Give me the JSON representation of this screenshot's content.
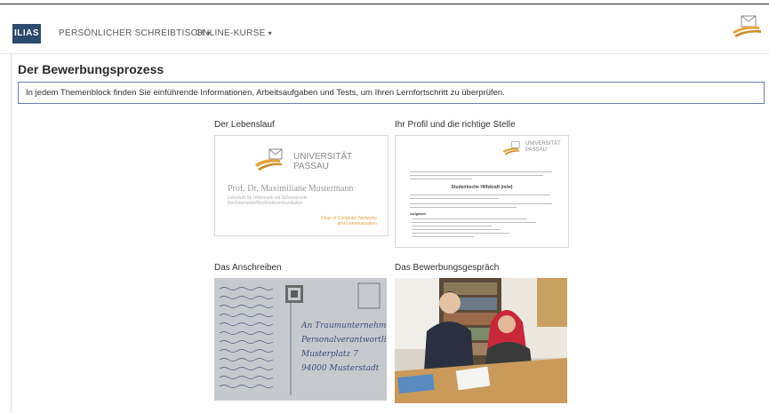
{
  "header": {
    "logo_text": "ILIAS",
    "nav": [
      {
        "label": "PERSÖNLICHER SCHREIBTISCH"
      },
      {
        "label": "ONLINE-KURSE"
      }
    ]
  },
  "page": {
    "title": "Der Bewerbungsprozess",
    "info": "In jedem Themenblock finden Sie einführende Informationen, Arbeitsaufgaben und Tests, um Ihren Lernfortschritt zu überprüfen."
  },
  "tiles": [
    {
      "title": "Der Lebenslauf"
    },
    {
      "title": "Ihr Profil und die richtige Stelle"
    },
    {
      "title": "Das Anschreiben"
    },
    {
      "title": "Das Bewerbungsgespräch"
    }
  ],
  "cv": {
    "uni_line1": "UNIVERSITÄT",
    "uni_line2": "PASSAU",
    "name": "Prof. Dr. Maximiliane Mustermann",
    "sub1": "Lehrstuhl für Informatik mit Schwerpunkt",
    "sub2": "Rechnernetze/Rechnerkommunikation",
    "chair1": "Chair of Computer Networks",
    "chair2": "and Communication"
  },
  "job": {
    "uni_line1": "UNIVERSITÄT",
    "uni_line2": "PASSAU",
    "heading": "Studentische Hilfskraft (m/w)",
    "aufgaben": "Aufgaben"
  },
  "postcard": {
    "address": [
      "An Traumunternehmen",
      "Personalverantwortlicher",
      "Musterplatz 7",
      "94000 Musterstadt"
    ]
  },
  "colors": {
    "logo_bg": "#2c4a6b",
    "info_border": "#6d7fb3",
    "uni_gold": "#e8a33c",
    "uni_gray": "#8a8a8a"
  }
}
